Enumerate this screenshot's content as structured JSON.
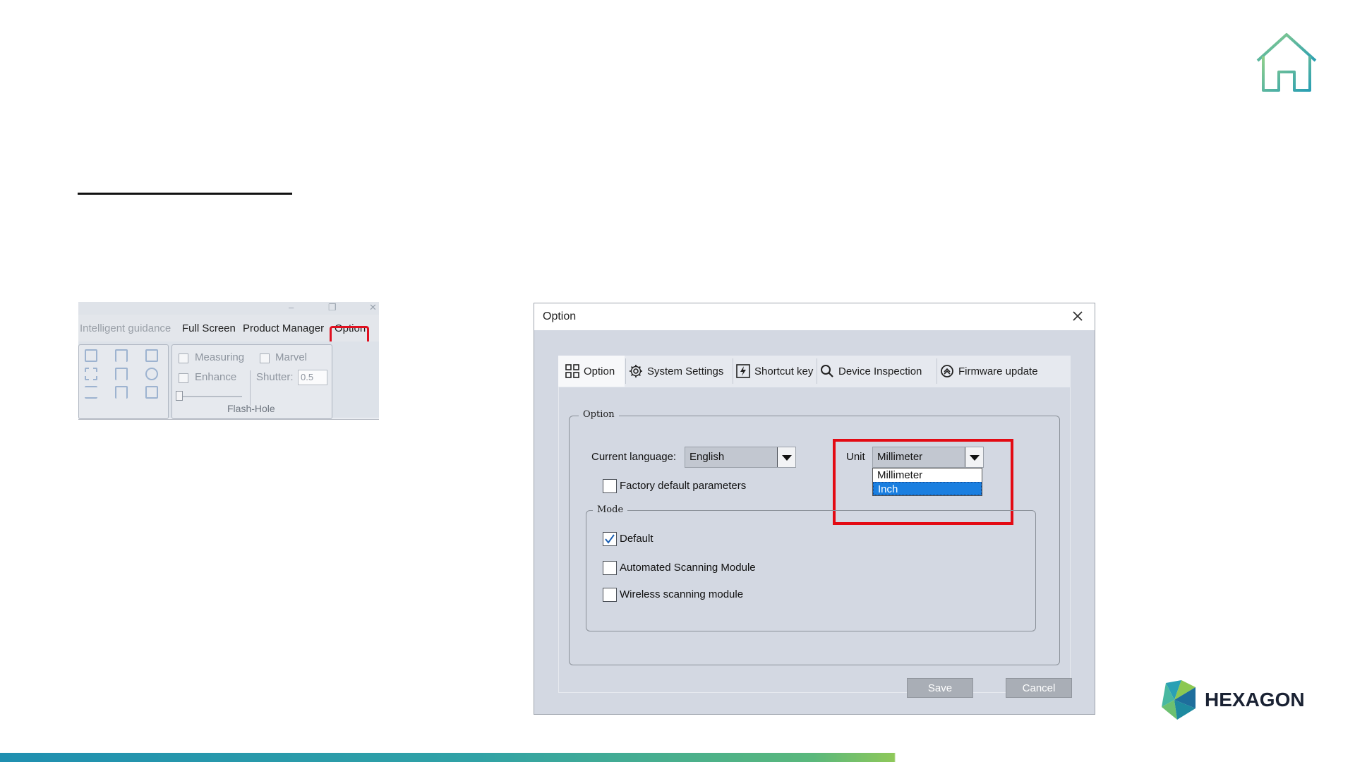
{
  "slide": {
    "brand": "HEXAGON",
    "colors": {
      "highlight": "#e30a13",
      "accent_teal": "#2aa3a6",
      "accent_green": "#8ec85a"
    }
  },
  "ribbon": {
    "menu": [
      {
        "label": "Intelligent guidance",
        "dim": true
      },
      {
        "label": "Full Screen"
      },
      {
        "label": "Product Manager"
      },
      {
        "label": "Option",
        "highlighted": true
      }
    ],
    "checks": {
      "measuring": "Measuring",
      "marvel": "Marvel",
      "enhance": "Enhance"
    },
    "shutter_label": "Shutter:",
    "shutter_value": "0.5",
    "group_title": "Flash-Hole"
  },
  "dialog": {
    "title": "Option",
    "tabs": [
      {
        "label": "Option",
        "icon": "grid-icon",
        "active": true
      },
      {
        "label": "System Settings",
        "icon": "gear-icon"
      },
      {
        "label": "Shortcut key",
        "icon": "lightning-icon"
      },
      {
        "label": "Device Inspection",
        "icon": "search-icon"
      },
      {
        "label": "Firmware update",
        "icon": "update-icon"
      }
    ],
    "option_group": "Option",
    "current_language_label": "Current language:",
    "current_language_value": "English",
    "unit_label": "Unit",
    "unit_value": "Millimeter",
    "unit_options": [
      "Millimeter",
      "Inch"
    ],
    "unit_selected_option": "Inch",
    "factory_default_label": "Factory default parameters",
    "mode_group": "Mode",
    "modes": [
      {
        "label": "Default",
        "checked": true
      },
      {
        "label": "Automated Scanning Module",
        "checked": false
      },
      {
        "label": "Wireless scanning module",
        "checked": false
      }
    ],
    "save_label": "Save",
    "cancel_label": "Cancel"
  }
}
